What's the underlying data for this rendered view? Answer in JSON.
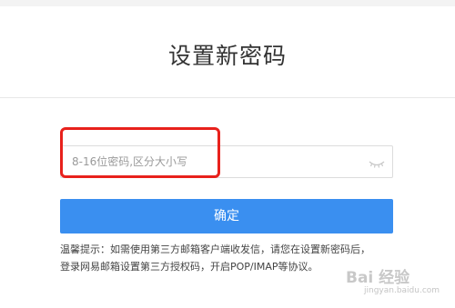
{
  "page": {
    "title": "设置新密码"
  },
  "form": {
    "password_placeholder": "8-16位密码,区分大小写",
    "password_value": "",
    "visibility_icon": "eye-closed-icon",
    "confirm_label": "确定"
  },
  "tip": {
    "line1": "温馨提示：如需使用第三方邮箱客户端收发信，请您在设置新密码后，",
    "line2": "登录网易邮箱设置第三方授权码，开启POP/IMAP等协议。"
  },
  "watermark": {
    "main": "Bai 经验",
    "sub": "jingyan.baidu.com"
  },
  "colors": {
    "accent": "#3a8ff0",
    "highlight": "#e8211c"
  }
}
